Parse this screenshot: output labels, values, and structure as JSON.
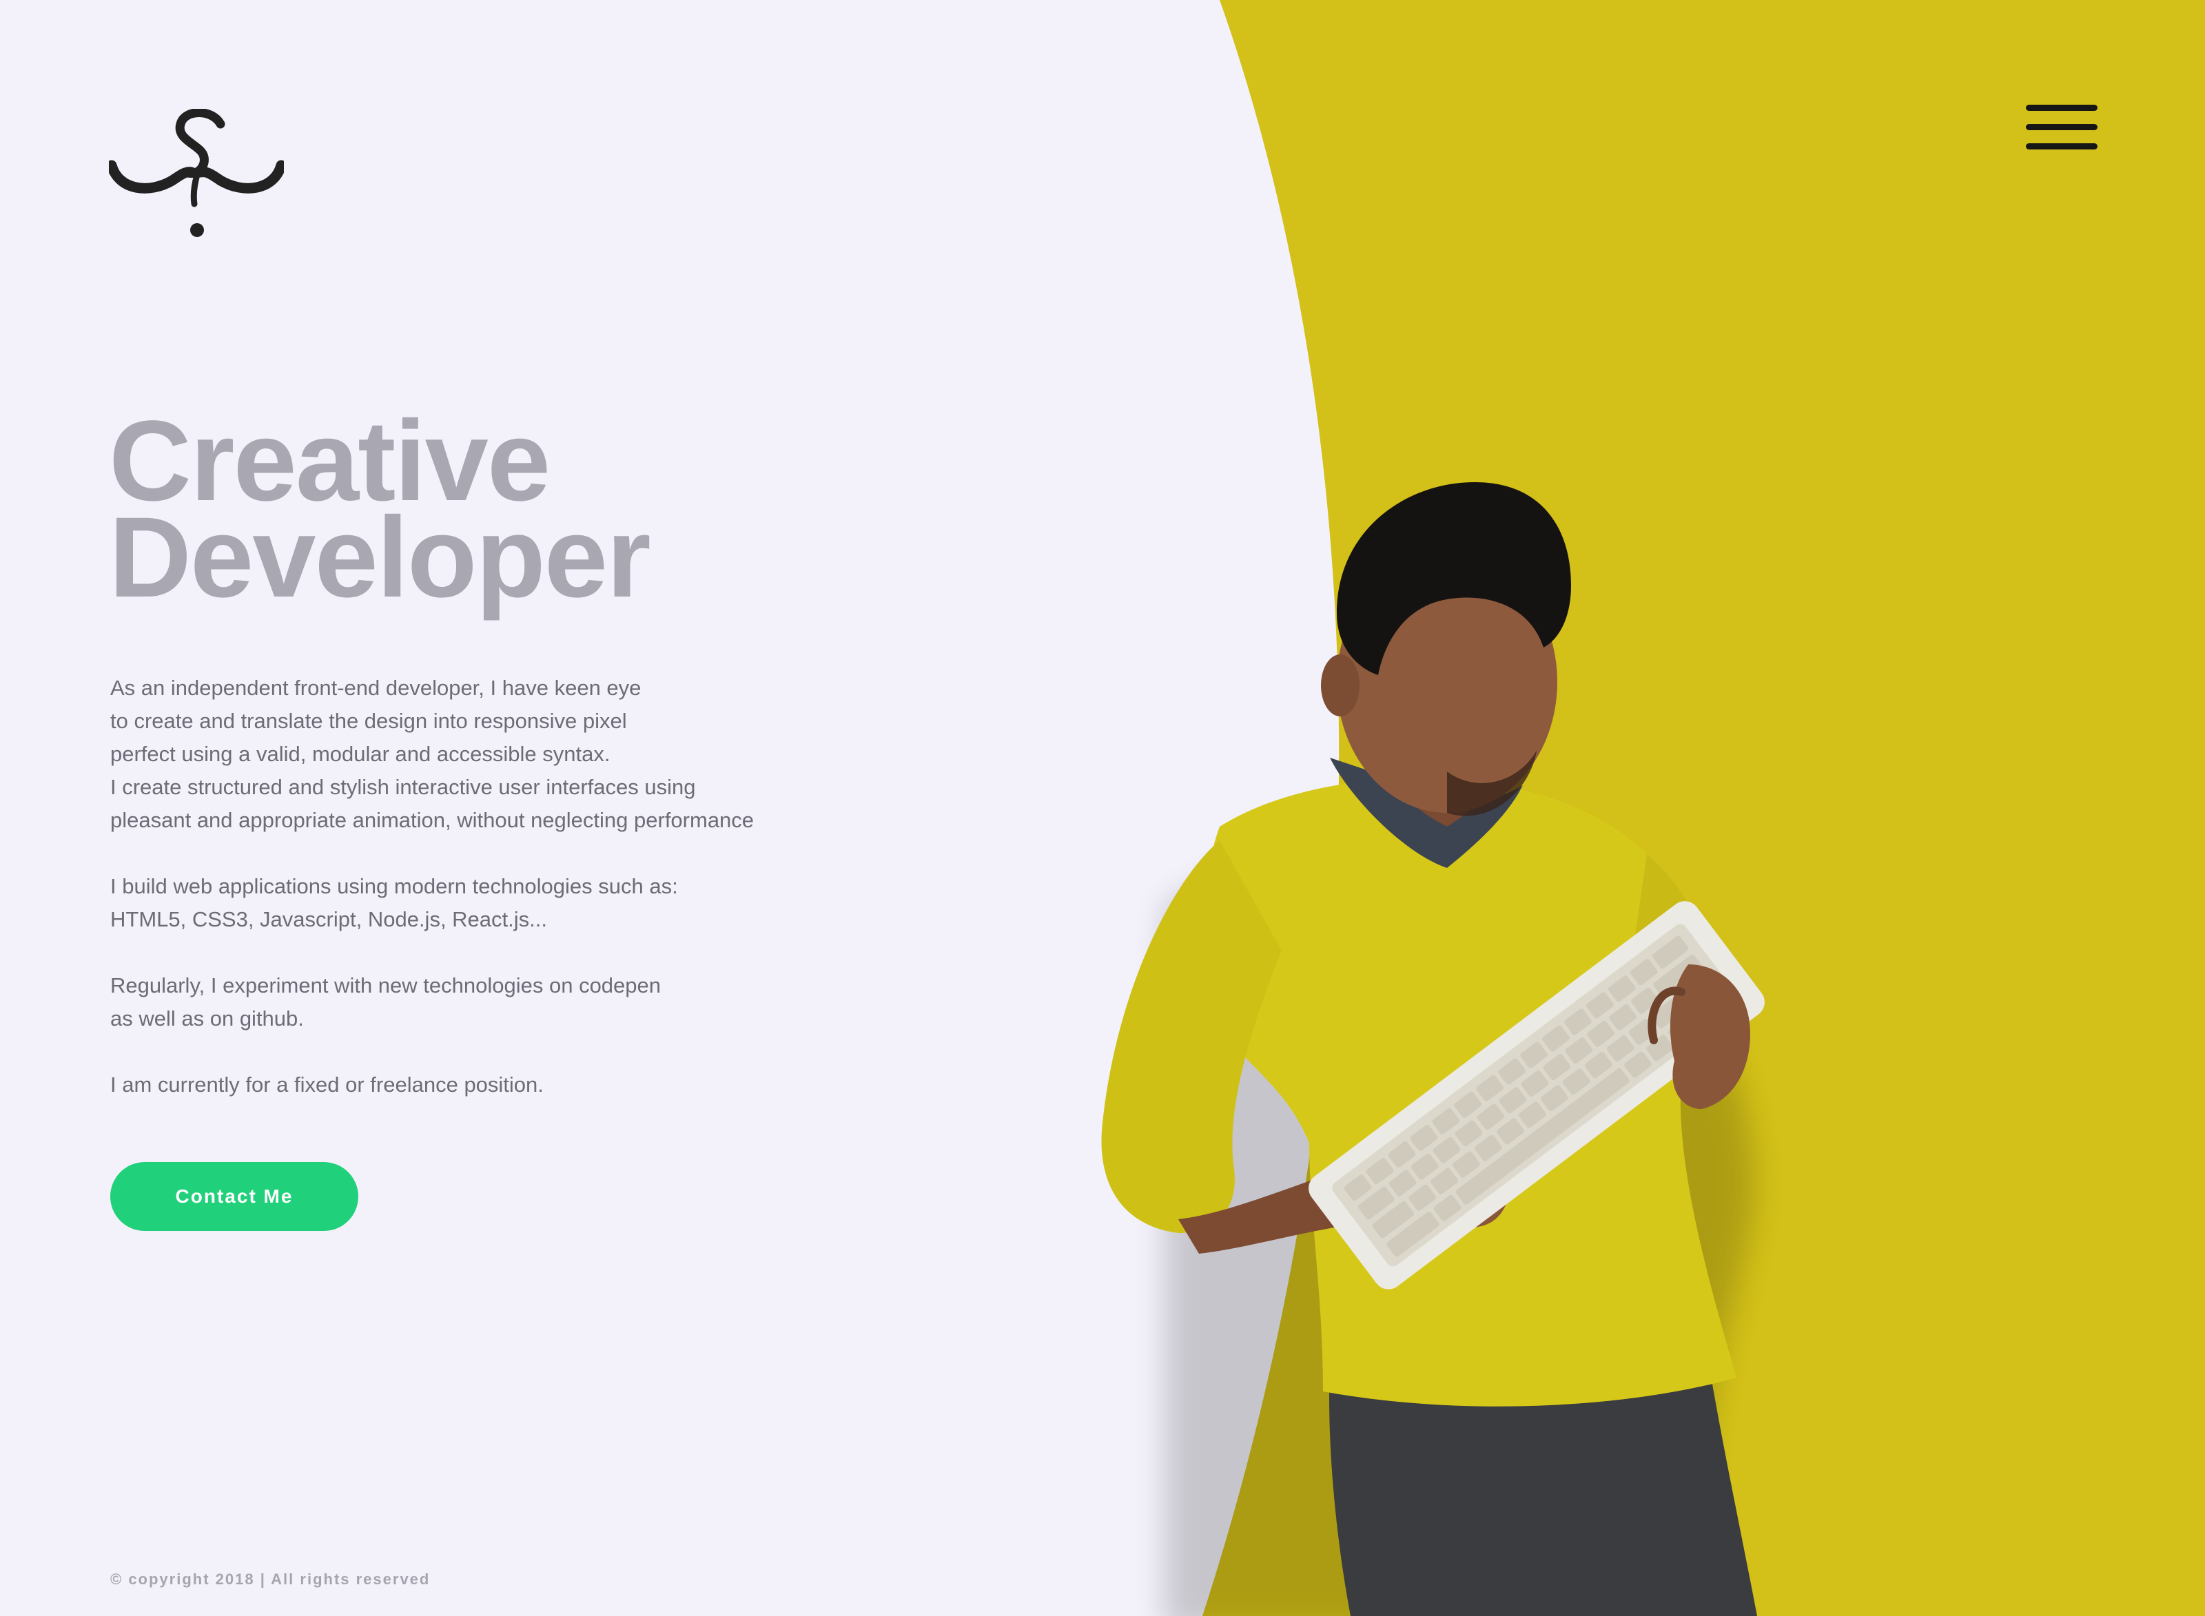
{
  "header": {
    "logo_icon": "calligraphic-signature-logo",
    "menu_icon": "hamburger-menu-icon"
  },
  "hero": {
    "title_line1": "Creative",
    "title_line2": "Developer",
    "paragraphs": [
      {
        "lines": [
          "As an independent front-end developer, I have keen eye",
          "to create and translate the design into responsive pixel",
          "perfect using a valid, modular and accessible syntax.",
          "I create structured and stylish interactive user interfaces using",
          "pleasant and appropriate animation, without neglecting performance"
        ]
      },
      {
        "lines": [
          "I build web applications using modern technologies such as:",
          "HTML5, CSS3, Javascript, Node.js, React.js..."
        ]
      },
      {
        "lines": [
          "Regularly, I experiment with new technologies on codepen",
          "as well as on github."
        ]
      },
      {
        "lines": [
          "I am currently   for a fixed or freelance position."
        ]
      }
    ],
    "contact_button": "Contact Me"
  },
  "footer": {
    "copyright": "© copyright 2018 | All rights reserved"
  },
  "colors": {
    "background": "#f3f2fb",
    "accent_yellow": "#d3c018",
    "headline_gray": "#a9a7b1",
    "button_green": "#21d07a"
  }
}
